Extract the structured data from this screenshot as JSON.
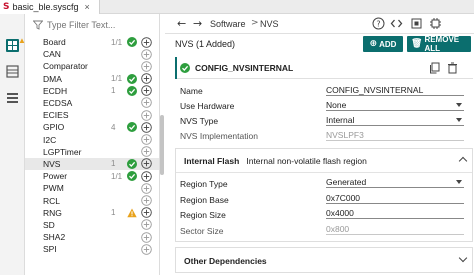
{
  "tab": {
    "file_name": "basic_ble.syscfg",
    "close_glyph": "×",
    "logo_glyph": "S"
  },
  "filter": {
    "placeholder": "Type Filter Text..."
  },
  "modules": [
    {
      "name": "Board",
      "count": "1/1",
      "status": "ok"
    },
    {
      "name": "CAN",
      "count": "",
      "status": ""
    },
    {
      "name": "Comparator",
      "count": "",
      "status": ""
    },
    {
      "name": "DMA",
      "count": "1/1",
      "status": "ok"
    },
    {
      "name": "ECDH",
      "count": "1",
      "status": "ok"
    },
    {
      "name": "ECDSA",
      "count": "",
      "status": ""
    },
    {
      "name": "ECIES",
      "count": "",
      "status": ""
    },
    {
      "name": "GPIO",
      "count": "4",
      "status": "ok"
    },
    {
      "name": "I2C",
      "count": "",
      "status": ""
    },
    {
      "name": "LGPTimer",
      "count": "",
      "status": ""
    },
    {
      "name": "NVS",
      "count": "1",
      "status": "ok",
      "selected": true
    },
    {
      "name": "Power",
      "count": "1/1",
      "status": "ok"
    },
    {
      "name": "PWM",
      "count": "",
      "status": ""
    },
    {
      "name": "RCL",
      "count": "",
      "status": ""
    },
    {
      "name": "RNG",
      "count": "1",
      "status": "warn"
    },
    {
      "name": "SD",
      "count": "",
      "status": ""
    },
    {
      "name": "SHA2",
      "count": "",
      "status": ""
    },
    {
      "name": "SPI",
      "count": "",
      "status": ""
    }
  ],
  "toolbar": {
    "back_glyph": "←",
    "forward_glyph": "→",
    "sep_glyph": ">",
    "breadcrumb": [
      "Software",
      "NVS"
    ],
    "icons": [
      "help-icon",
      "code-view-icon",
      "memory-icon",
      "chip-icon"
    ]
  },
  "module_panel": {
    "title": "NVS (1 Added)",
    "add_label": "ADD",
    "remove_label": "REMOVE ALL",
    "instance_name": "CONFIG_NVSINTERNAL",
    "properties": [
      {
        "label": "Name",
        "value": "CONFIG_NVSINTERNAL",
        "kind": "text"
      },
      {
        "label": "Use Hardware",
        "value": "None",
        "kind": "select"
      },
      {
        "label": "NVS Type",
        "value": "Internal",
        "kind": "select"
      },
      {
        "label": "NVS Implementation",
        "value": "NVSLPF3",
        "kind": "readonly"
      }
    ],
    "internal_flash": {
      "title": "Internal Flash",
      "description": "Internal non-volatile flash region",
      "properties": [
        {
          "label": "Region Type",
          "value": "Generated",
          "kind": "select"
        },
        {
          "label": "Region Base",
          "value": "0x7C000",
          "kind": "text"
        },
        {
          "label": "Region Size",
          "value": "0x4000",
          "kind": "text"
        },
        {
          "label": "Sector Size",
          "value": "0x800",
          "kind": "readonly"
        }
      ]
    },
    "other_dependencies": {
      "title": "Other Dependencies"
    }
  },
  "colors": {
    "accent": "#0b6e6e",
    "ok": "#2e9e3e",
    "warn": "#e8a21c",
    "brand": "#c8102e"
  }
}
